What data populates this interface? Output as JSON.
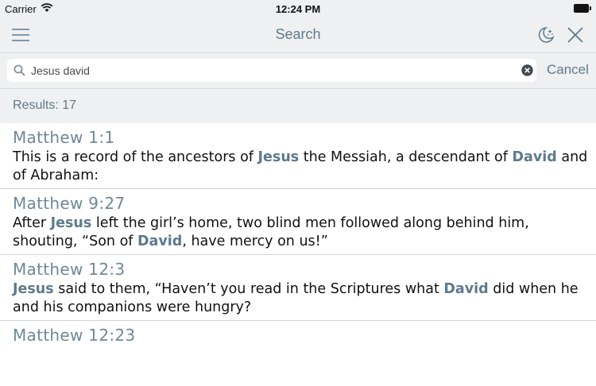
{
  "status_bar": {
    "carrier": "Carrier",
    "time": "12:24 PM"
  },
  "nav": {
    "title": "Search"
  },
  "search": {
    "query": "Jesus david",
    "cancel_label": "Cancel"
  },
  "results_header": "Results: 17",
  "results": [
    {
      "reference": "Matthew 1:1",
      "segments": [
        {
          "t": "This is a record of the ancestors of ",
          "h": false
        },
        {
          "t": "Jesus",
          "h": true
        },
        {
          "t": " the Messiah, a descendant of ",
          "h": false
        },
        {
          "t": "David",
          "h": true
        },
        {
          "t": " and of Abraham:",
          "h": false
        }
      ]
    },
    {
      "reference": "Matthew 9:27",
      "segments": [
        {
          "t": "After ",
          "h": false
        },
        {
          "t": "Jesus",
          "h": true
        },
        {
          "t": " left the girl’s home, two blind men followed along behind him, shouting, “Son of ",
          "h": false
        },
        {
          "t": "David",
          "h": true
        },
        {
          "t": ", have mercy on us!”",
          "h": false
        }
      ]
    },
    {
      "reference": "Matthew 12:3",
      "segments": [
        {
          "t": "Jesus",
          "h": true
        },
        {
          "t": " said to them, “Haven’t you read in the Scriptures what ",
          "h": false
        },
        {
          "t": "David",
          "h": true
        },
        {
          "t": " did when he and his companions were hungry?",
          "h": false
        }
      ]
    },
    {
      "reference": "Matthew 12:23",
      "segments": []
    }
  ],
  "icons": {
    "menu": "hamburger-menu-icon",
    "night_mode": "moon-stars-icon",
    "close": "close-x-icon",
    "search": "magnifier-icon",
    "clear": "clear-circle-x-icon"
  },
  "colors": {
    "accent": "#5d7a8c",
    "bar_bg": "#eef0f2",
    "text": "#111111"
  }
}
